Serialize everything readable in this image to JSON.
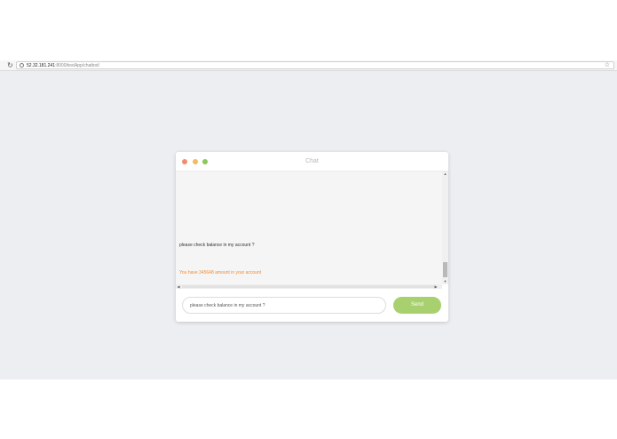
{
  "browser": {
    "reload_icon": "reload-icon",
    "info_icon": "info-icon",
    "url_host": "52.32.181.241",
    "url_path": ":8000/testApp/chatbot/",
    "star_icon": "star-icon"
  },
  "chat": {
    "title": "Chat",
    "window_dots": {
      "close_color": "#f28c6c",
      "minimize_color": "#f2bb5b",
      "maximize_color": "#8bc75a"
    },
    "messages": [
      {
        "sender": "user",
        "text": "please check balance in my account ?"
      },
      {
        "sender": "bot",
        "text": "You have 345648 amount in your account",
        "color": "#f28b35"
      }
    ],
    "input": {
      "value": "please check balance in my account ?",
      "placeholder": ""
    },
    "send_label": "Send",
    "send_color": "#a9d06e"
  }
}
